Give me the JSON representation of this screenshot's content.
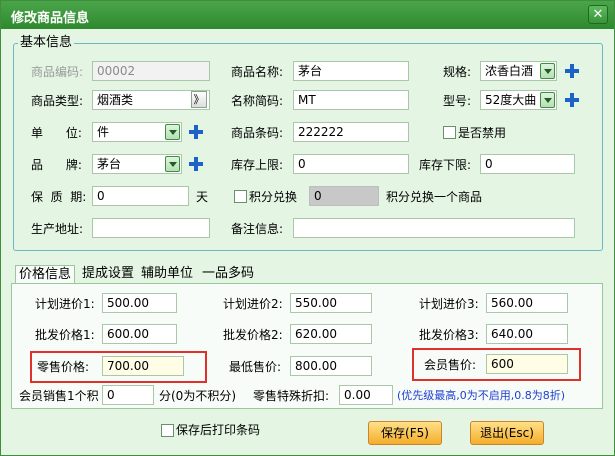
{
  "window": {
    "title": "修改商品信息",
    "close_label": "✕"
  },
  "basic": {
    "group_label": "基本信息",
    "code_label": "商品编码:",
    "code_value": "00002",
    "name_label": "商品名称:",
    "name_value": "茅台",
    "spec_label": "规格:",
    "spec_value": "浓香白酒",
    "type_label": "商品类型:",
    "type_value": "烟酒类",
    "type_button": "》",
    "short_label": "名称简码:",
    "short_value": "MT",
    "model_label": "型号:",
    "model_value": "52度大曲",
    "unit_label": "单      位:",
    "unit_value": "件",
    "barcode_label": "商品条码:",
    "barcode_value": "222222",
    "disabled_label": "是否禁用",
    "brand_label": "品      牌:",
    "brand_value": "茅台",
    "stock_max_label": "库存上限:",
    "stock_max_value": "0",
    "stock_min_label": "库存下限:",
    "stock_min_value": "0",
    "shelf_label": "保  质  期:",
    "shelf_value": "0",
    "shelf_unit": "天",
    "points_exchange_label": "积分兑换",
    "points_exchange_value": "0",
    "points_exchange_suffix": "积分兑换一个商品",
    "origin_label": "生产地址:",
    "origin_value": "",
    "note_label": "备注信息:",
    "note_value": ""
  },
  "tabs": [
    {
      "label": "价格信息"
    },
    {
      "label": "提成设置"
    },
    {
      "label": "辅助单位"
    },
    {
      "label": "一品多码"
    }
  ],
  "price": {
    "plan1_label": "计划进价1:",
    "plan1_value": "500.00",
    "plan2_label": "计划进价2:",
    "plan2_value": "550.00",
    "plan3_label": "计划进价3:",
    "plan3_value": "560.00",
    "whole1_label": "批发价格1:",
    "whole1_value": "600.00",
    "whole2_label": "批发价格2:",
    "whole2_value": "620.00",
    "whole3_label": "批发价格3:",
    "whole3_value": "640.00",
    "retail_label": "零售价格:",
    "retail_value": "700.00",
    "min_label": "最低售价:",
    "min_value": "800.00",
    "member_label": "会员售价:",
    "member_value": "600",
    "member_points_label": "会员销售1个积",
    "member_points_value": "0",
    "member_points_suffix": "分(0为不积分)",
    "special_discount_label": "零售特殊折扣:",
    "special_discount_value": "0.00",
    "hint": "(优先级最高,0为不启用,0.8为8折)"
  },
  "footer": {
    "print_label": "保存后打印条码",
    "save_label": "保存(F5)",
    "exit_label": "退出(Esc)"
  },
  "colors": {
    "accent": "#2f8a2f",
    "highlight_border": "#e0302a",
    "button": "#f5ad2a",
    "hint": "#1e3fd0"
  }
}
